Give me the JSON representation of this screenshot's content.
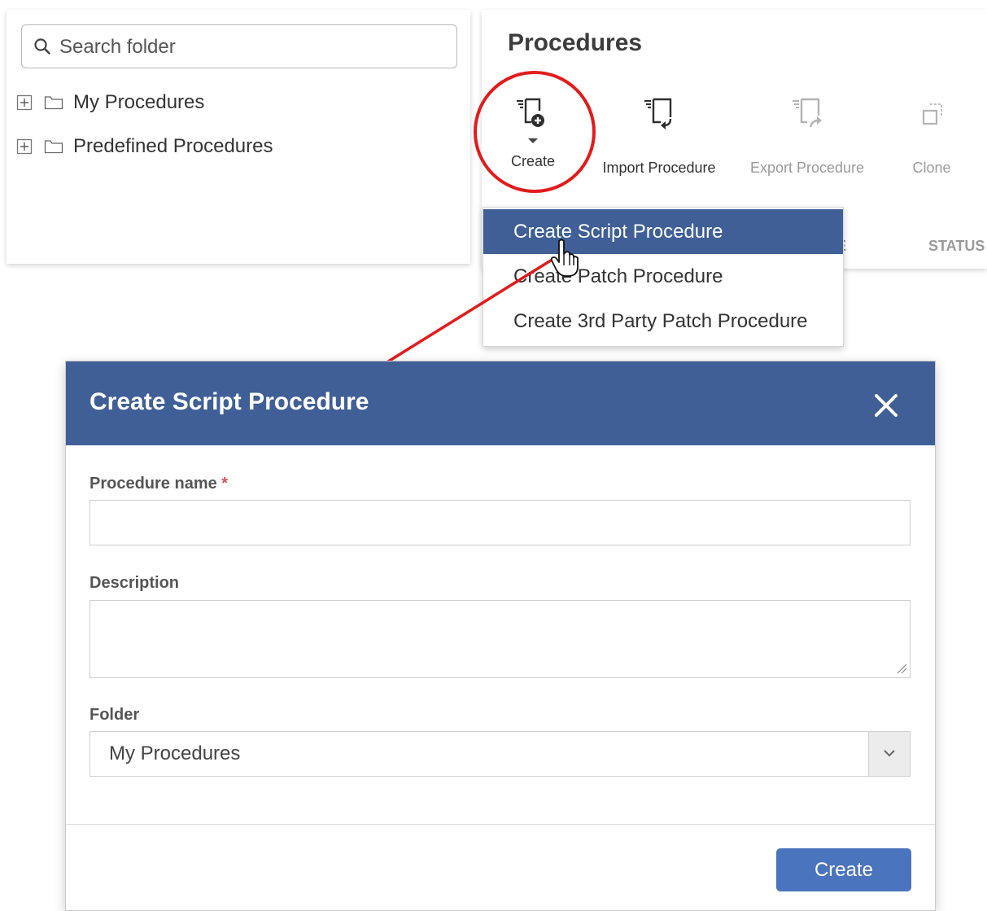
{
  "folder_panel": {
    "search_placeholder": "Search folder",
    "tree": [
      {
        "label": "My Procedures",
        "icon": "folder-icon"
      },
      {
        "label": "Predefined Procedures",
        "icon": "folder-icon"
      }
    ]
  },
  "procedures_panel": {
    "title": "Procedures",
    "toolbar": {
      "create": "Create",
      "import": "Import Procedure",
      "export": "Export Procedure",
      "clone": "Clone"
    },
    "column_headers": {
      "partial_left": "E",
      "status": "STATUS"
    }
  },
  "create_menu": {
    "items": [
      {
        "label": "Create Script Procedure",
        "active": true
      },
      {
        "label": "Create Patch Procedure",
        "active": false
      },
      {
        "label": "Create 3rd Party Patch Procedure",
        "active": false
      }
    ]
  },
  "modal": {
    "title": "Create Script Procedure",
    "fields": {
      "name_label": "Procedure name",
      "required_mark": "*",
      "name_value": "",
      "description_label": "Description",
      "description_value": "",
      "folder_label": "Folder",
      "folder_value": "My Procedures"
    },
    "create_button": "Create"
  },
  "colors": {
    "header_blue": "#3f5f96",
    "button_blue": "#4a74be",
    "annotation_red": "#e31b1b"
  }
}
